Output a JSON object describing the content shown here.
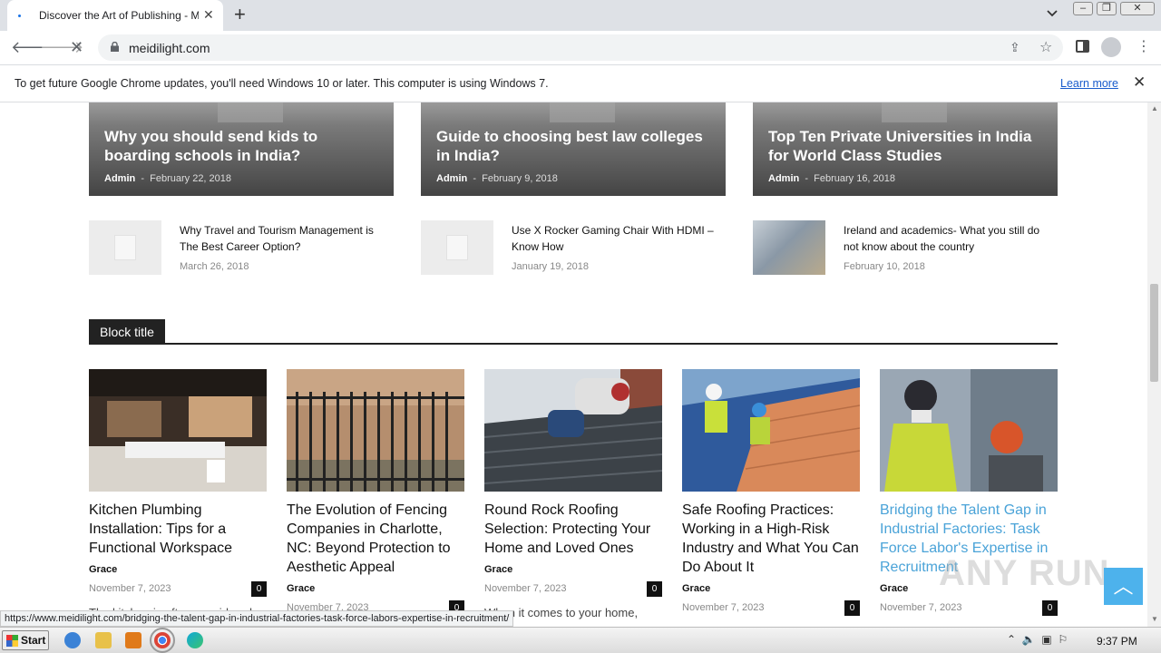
{
  "browser": {
    "tab_title": "Discover the Art of Publishing - Meid",
    "new_tab_glyph": "+",
    "url": "meidilight.com"
  },
  "infobar": {
    "message": "To get future Google Chrome updates, you'll need Windows 10 or later. This computer is using Windows 7.",
    "learn_more": "Learn more"
  },
  "featured": [
    {
      "title": "Why you should send kids to boarding schools in India?",
      "author": "Admin",
      "date": "February 22, 2018"
    },
    {
      "title": "Guide to choosing best law colleges in India?",
      "author": "Admin",
      "date": "February 9, 2018"
    },
    {
      "title": "Top Ten Private Universities in India for World Class Studies",
      "author": "Admin",
      "date": "February 16, 2018"
    }
  ],
  "small_posts": [
    {
      "title": "Why Travel and Tourism Management is The Best Career Option?",
      "date": "March 26, 2018",
      "thumb": "placeholder"
    },
    {
      "title": "Use X Rocker Gaming Chair With HDMI – Know How",
      "date": "January 19, 2018",
      "thumb": "placeholder"
    },
    {
      "title": "Ireland and academics- What you still do not know about the country",
      "date": "February 10, 2018",
      "thumb": "photo"
    }
  ],
  "block_title": "Block title",
  "posts": [
    {
      "title": "Kitchen Plumbing Installation: Tips for a Functional Workspace",
      "author": "Grace",
      "date": "November 7, 2023",
      "comments": "0",
      "excerpt": "The kitchen is often considered"
    },
    {
      "title": "The Evolution of Fencing Companies in Charlotte, NC: Beyond Protection to Aesthetic Appeal",
      "author": "Grace",
      "date": "November 7, 2023",
      "comments": "0",
      "excerpt": ""
    },
    {
      "title": "Round Rock Roofing Selection: Protecting Your Home and Loved Ones",
      "author": "Grace",
      "date": "November 7, 2023",
      "comments": "0",
      "excerpt": "When it comes to your home,"
    },
    {
      "title": "Safe Roofing Practices: Working in a High-Risk Industry and What You Can Do About It",
      "author": "Grace",
      "date": "November 7, 2023",
      "comments": "0",
      "excerpt": ""
    },
    {
      "title": "Bridging the Talent Gap in Industrial Factories: Task Force Labor's Expertise in Recruitment",
      "author": "Grace",
      "date": "November 7, 2023",
      "comments": "0",
      "excerpt": ""
    }
  ],
  "status_url": "https://www.meidilight.com/bridging-the-talent-gap-in-industrial-factories-task-force-labors-expertise-in-recruitment/",
  "watermark": "ANY RUN",
  "taskbar": {
    "start_label": "Start",
    "clock": "9:37 PM"
  },
  "colors": {
    "link_hover": "#4aa3d8",
    "back_to_top": "#4db2ec",
    "block_title_bg": "#222222"
  },
  "icons": [
    "back-arrow-icon",
    "forward-arrow-icon",
    "reload-stop-icon",
    "lock-icon",
    "share-icon",
    "star-icon",
    "side-panel-icon",
    "profile-icon",
    "kebab-menu-icon",
    "close-icon",
    "chevron-up-icon"
  ]
}
